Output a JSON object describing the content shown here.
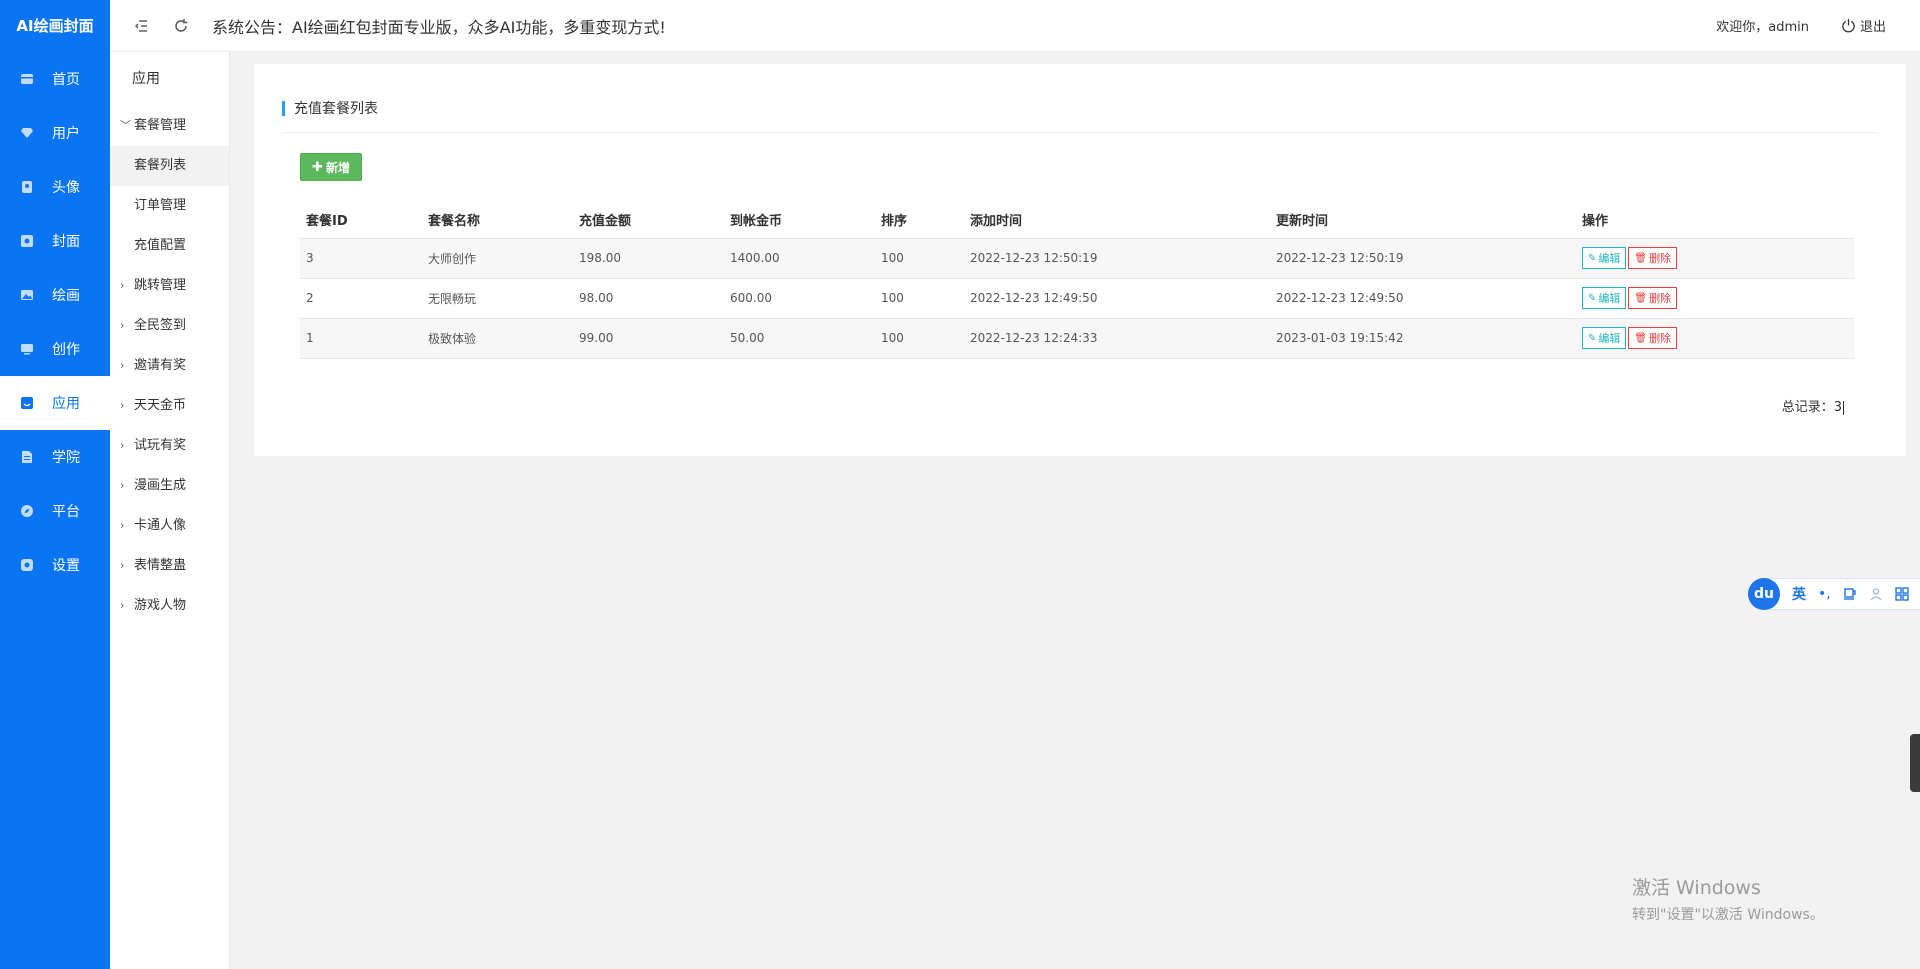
{
  "sidebar": {
    "logo": "AI绘画封面",
    "items": [
      {
        "label": "首页",
        "icon": "home-icon"
      },
      {
        "label": "用户",
        "icon": "diamond-icon"
      },
      {
        "label": "头像",
        "icon": "avatar-icon"
      },
      {
        "label": "封面",
        "icon": "cover-icon"
      },
      {
        "label": "绘画",
        "icon": "image-icon"
      },
      {
        "label": "创作",
        "icon": "monitor-icon"
      },
      {
        "label": "应用",
        "icon": "app-icon",
        "active": true
      },
      {
        "label": "学院",
        "icon": "document-icon"
      },
      {
        "label": "平台",
        "icon": "compass-icon"
      },
      {
        "label": "设置",
        "icon": "settings-icon"
      }
    ]
  },
  "subnav": {
    "title": "应用",
    "groups": [
      {
        "label": "套餐管理",
        "expanded": true,
        "children": [
          "套餐列表",
          "订单管理",
          "充值配置"
        ]
      },
      {
        "label": "跳转管理"
      },
      {
        "label": "全民签到"
      },
      {
        "label": "邀请有奖"
      },
      {
        "label": "天天金币"
      },
      {
        "label": "试玩有奖"
      },
      {
        "label": "漫画生成"
      },
      {
        "label": "卡通人像"
      },
      {
        "label": "表情整蛊"
      },
      {
        "label": "游戏人物"
      }
    ]
  },
  "topbar": {
    "notice": "系统公告：AI绘画红包封面专业版，众多AI功能，多重变现方式!",
    "welcome": "欢迎你，admin",
    "logout": "退出"
  },
  "content": {
    "title": "充值套餐列表",
    "add_button": "新增",
    "columns": [
      "套餐ID",
      "套餐名称",
      "充值金额",
      "到帐金币",
      "排序",
      "添加时间",
      "更新时间",
      "操作"
    ],
    "rows": [
      {
        "id": "3",
        "name": "大师创作",
        "amount": "198.00",
        "coins": "1400.00",
        "sort": "100",
        "created": "2022-12-23 12:50:19",
        "updated": "2022-12-23 12:50:19"
      },
      {
        "id": "2",
        "name": "无限畅玩",
        "amount": "98.00",
        "coins": "600.00",
        "sort": "100",
        "created": "2022-12-23 12:49:50",
        "updated": "2022-12-23 12:49:50"
      },
      {
        "id": "1",
        "name": "极致体验",
        "amount": "99.00",
        "coins": "50.00",
        "sort": "100",
        "created": "2022-12-23 12:24:33",
        "updated": "2023-01-03 19:15:42"
      }
    ],
    "edit_label": "编辑",
    "delete_label": "删除",
    "total_label": "总记录：",
    "total_value": "3"
  },
  "ime": {
    "logo": "du",
    "lang": "英",
    "punct": "•,"
  },
  "watermark": {
    "line1": "激活 Windows",
    "line2": "转到\"设置\"以激活 Windows。"
  }
}
